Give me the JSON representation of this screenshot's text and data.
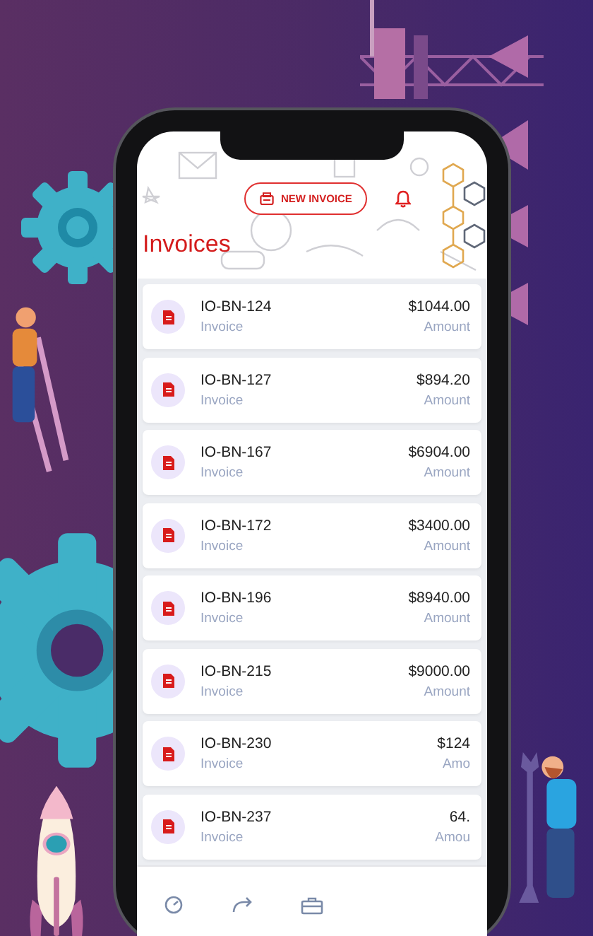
{
  "header": {
    "button": "NEW INVOICE",
    "title": "Invoices"
  },
  "invoices": [
    {
      "number": "IO-BN-124",
      "label": "Invoice",
      "amount": "$1044.00",
      "amount_label": "Amount"
    },
    {
      "number": "IO-BN-127",
      "label": "Invoice",
      "amount": "$894.20",
      "amount_label": "Amount"
    },
    {
      "number": "IO-BN-167",
      "label": "Invoice",
      "amount": "$6904.00",
      "amount_label": "Amount"
    },
    {
      "number": "IO-BN-172",
      "label": "Invoice",
      "amount": "$3400.00",
      "amount_label": "Amount"
    },
    {
      "number": "IO-BN-196",
      "label": "Invoice",
      "amount": "$8940.00",
      "amount_label": "Amount"
    },
    {
      "number": "IO-BN-215",
      "label": "Invoice",
      "amount": "$9000.00",
      "amount_label": "Amount"
    },
    {
      "number": "IO-BN-230",
      "label": "Invoice",
      "amount": "$124",
      "amount_label": "Amo"
    },
    {
      "number": "IO-BN-237",
      "label": "Invoice",
      "amount": "64.",
      "amount_label": "Amou"
    }
  ],
  "nav": [
    {
      "kind": "gauge"
    },
    {
      "kind": "redo"
    },
    {
      "kind": "briefcase"
    }
  ]
}
